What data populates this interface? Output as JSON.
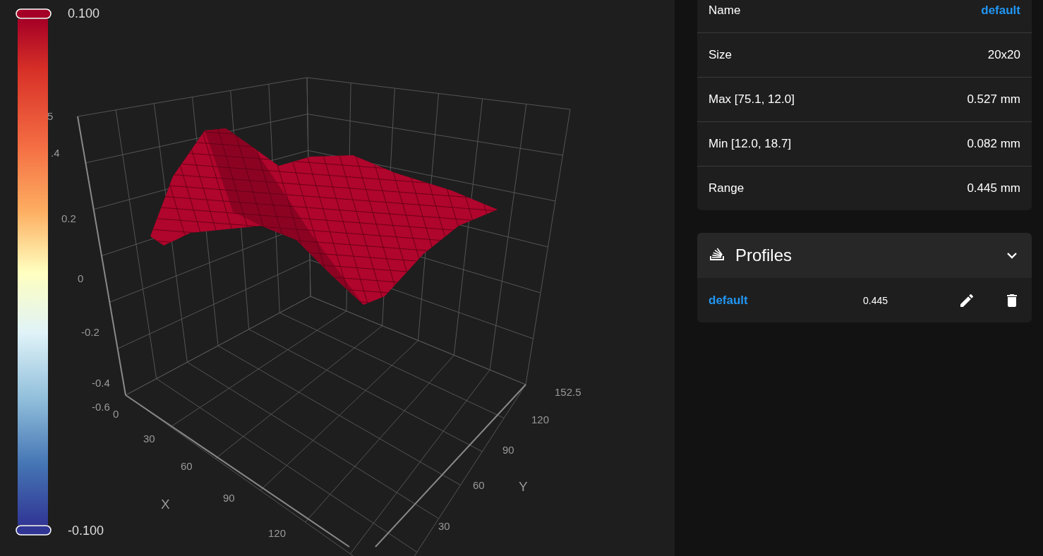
{
  "colorbar": {
    "max_label": "0.100",
    "min_label": "-0.100"
  },
  "plot": {
    "z_ticks": [
      "5",
      ".4",
      "0.2",
      "0",
      "-0.2",
      "-0.4",
      "-0.6"
    ],
    "x_ticks": [
      "0",
      "30",
      "60",
      "90",
      "120"
    ],
    "y_ticks": [
      "30",
      "60",
      "90",
      "120",
      "152.5"
    ],
    "x_label": "X",
    "y_label": "Y"
  },
  "stats": [
    {
      "label": "Name",
      "value": "default",
      "kind": "link"
    },
    {
      "label": "Size",
      "value": "20x20",
      "kind": "text"
    },
    {
      "label": "Max [75.1, 12.0]",
      "value": "0.527 mm",
      "kind": "text"
    },
    {
      "label": "Min [12.0, 18.7]",
      "value": "0.082 mm",
      "kind": "text"
    },
    {
      "label": "Range",
      "value": "0.445 mm",
      "kind": "text"
    }
  ],
  "profiles": {
    "title": "Profiles",
    "expanded": true,
    "items": [
      {
        "name": "default",
        "range": "0.445"
      }
    ]
  }
}
